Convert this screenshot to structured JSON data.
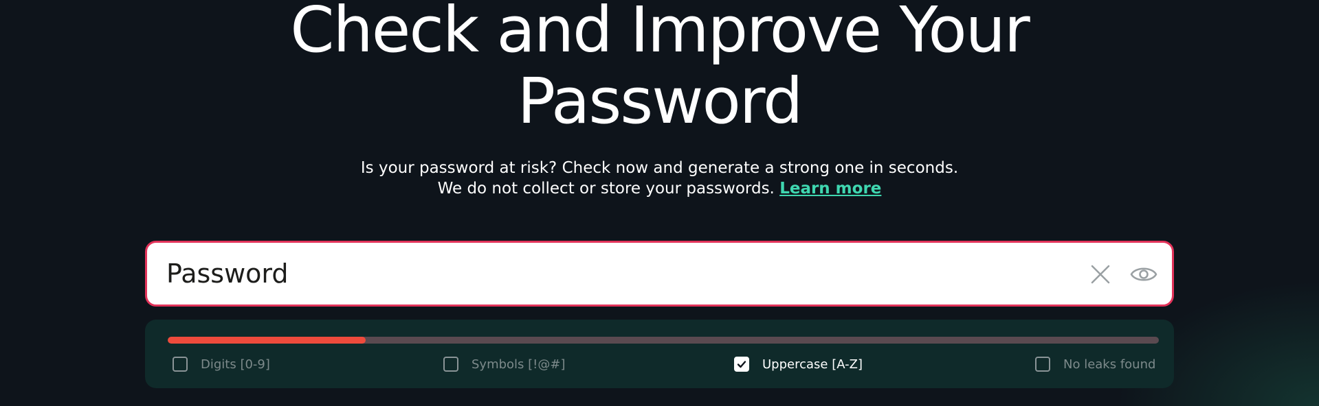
{
  "hero": {
    "title_line1": "Check and Improve Your",
    "title_line2": "Password"
  },
  "subtitle": {
    "line1": "Is your password at risk? Check now and generate a strong one in seconds.",
    "line2": "We do not collect or store your passwords.",
    "learn_more": "Learn more"
  },
  "password_field": {
    "placeholder": "Password",
    "value": "",
    "clear_icon": "close-icon",
    "toggle_icon": "eye-icon",
    "border_color": "#e2335a"
  },
  "strength": {
    "level": 0.2,
    "fill_color": "#ee4b3c",
    "track_color": "#5a4a50"
  },
  "criteria": [
    {
      "label": "Digits [0-9]",
      "checked": false
    },
    {
      "label": "Symbols [!@#]",
      "checked": false
    },
    {
      "label": "Uppercase [A-Z]",
      "checked": true
    },
    {
      "label": "No leaks found",
      "checked": false
    }
  ],
  "colors": {
    "background": "#0e141b",
    "accent": "#3fd7b0",
    "panel": "#0f2a2a"
  }
}
